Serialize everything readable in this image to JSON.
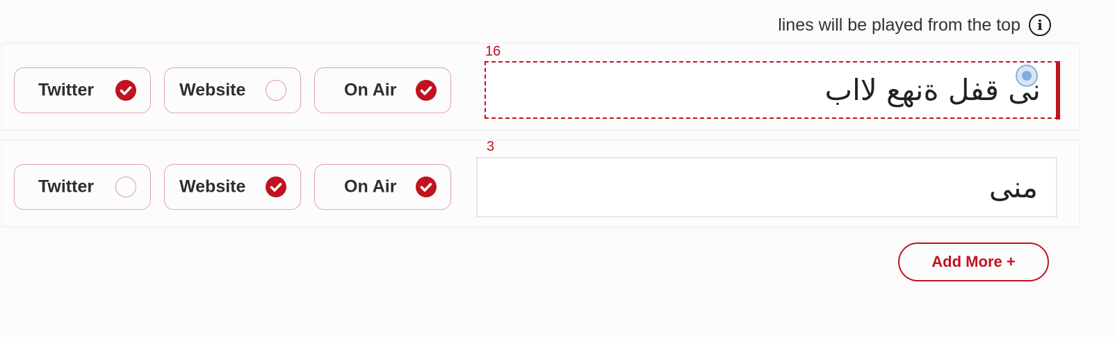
{
  "info": {
    "text": "lines will be played from the top",
    "icon": "info-icon",
    "icon_glyph": "i"
  },
  "rows": [
    {
      "counter": "16",
      "text": "نى قفل ةنهع لااب",
      "field_state": "focused",
      "options": [
        {
          "label": "Twitter",
          "checked": true
        },
        {
          "label": "Website",
          "checked": false
        },
        {
          "label": "On Air",
          "checked": true
        }
      ]
    },
    {
      "counter": "3",
      "text": "منى",
      "field_state": "default",
      "options": [
        {
          "label": "Twitter",
          "checked": false
        },
        {
          "label": "Website",
          "checked": true
        },
        {
          "label": "On Air",
          "checked": true
        }
      ]
    }
  ],
  "add_more": {
    "label": "Add More +"
  },
  "colors": {
    "accent": "#c1121f",
    "chip_border": "#e4a3a3",
    "text": "#2b2b2b"
  }
}
